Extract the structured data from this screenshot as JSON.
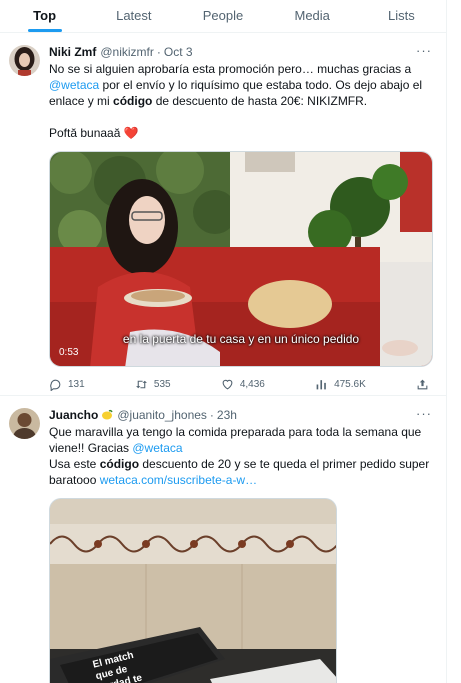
{
  "tabs": [
    {
      "label": "Top",
      "active": true
    },
    {
      "label": "Latest",
      "active": false
    },
    {
      "label": "People",
      "active": false
    },
    {
      "label": "Media",
      "active": false
    },
    {
      "label": "Lists",
      "active": false
    }
  ],
  "tweets": [
    {
      "name": "Niki Zmf",
      "handle": "@nikizmfr",
      "time": "Oct 3",
      "body": {
        "l1": "No se si alguien aprobaría esta promoción pero… muchas gracias a",
        "mention": "@wetaca",
        "l2a": " por el envío y lo riquísimo que estaba todo. Os dejo abajo el enlace y mi ",
        "bold": "código",
        "l2b": " de descuento de hasta 20€: NIKIZMFR.",
        "l3": "Poftă bunaaă ",
        "heart": "❤️"
      },
      "video": {
        "duration": "0:53",
        "subtitle": "en la puerta de tu casa y en un único pedido"
      },
      "actions": {
        "replies": "131",
        "retweets": "535",
        "likes": "4,436",
        "views": "475.6K"
      }
    },
    {
      "name": "Juancho",
      "emoji": "lemon-icon",
      "handle": "@juanito_jhones",
      "time": "23h",
      "body": {
        "l1": "Que maravilla ya tengo la comida preparada para toda la semana que viene!! Gracias ",
        "mention": "@wetaca",
        "l2a": "Usa este ",
        "bold": "código",
        "l2b": " descuento de 20 y se te queda el primer pedido super baratooo ",
        "link": "wetaca.com/suscribete-a-w…"
      },
      "image": {
        "book_title": "El match que de verdad te cuida"
      }
    }
  ],
  "colors": {
    "accent": "#1d9bf0",
    "text": "#0f1419",
    "secondary": "#536471",
    "border": "#eff3f4",
    "heart": "#f91880"
  }
}
